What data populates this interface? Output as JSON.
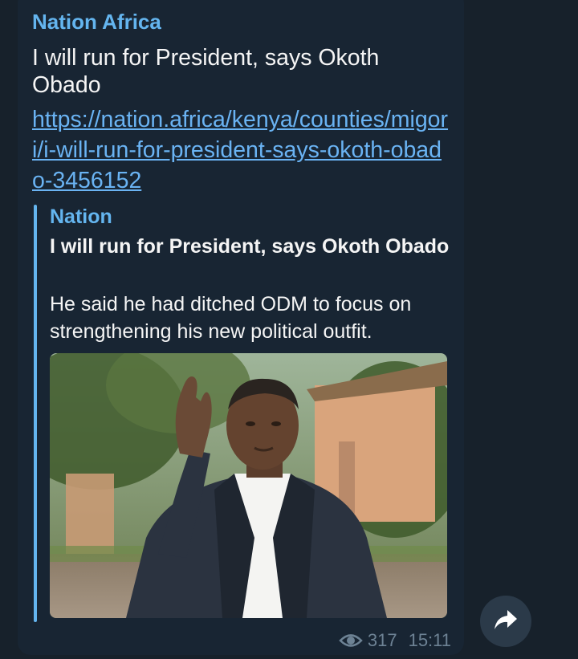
{
  "message": {
    "channel_name": "Nation Africa",
    "text": "I will run for President, says Okoth Obado",
    "link": "https://nation.africa/kenya/counties/migori/i-will-run-for-president-says-okoth-obado-3456152",
    "views": "317",
    "time": "15:11"
  },
  "link_preview": {
    "site_name": "Nation",
    "title": "I will run for President, says Okoth Obado",
    "description": "He said he had ditched ODM to focus on strengthening his new political outfit."
  },
  "icons": {
    "views": "eye-icon",
    "share": "share-arrow-icon"
  },
  "colors": {
    "background": "#17212b",
    "bubble": "#182533",
    "accent": "#64b5ef",
    "link": "#6ab3f3",
    "text": "#f5f5f5",
    "meta": "#6d8294"
  }
}
